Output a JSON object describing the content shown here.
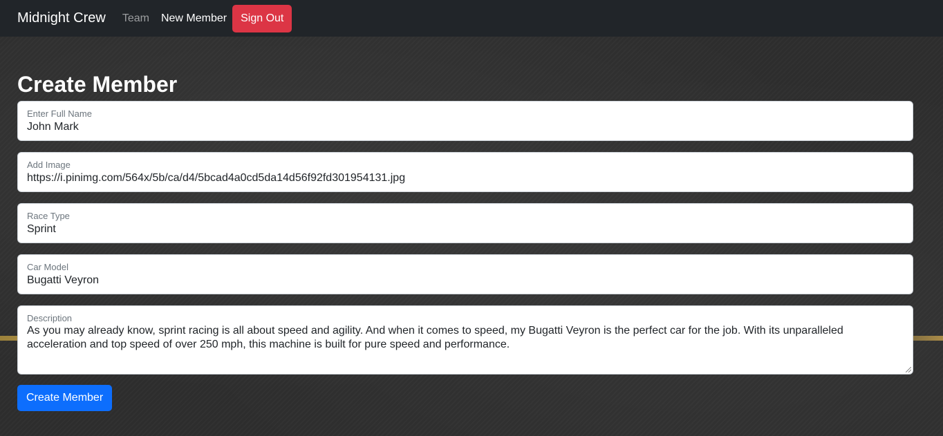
{
  "navbar": {
    "brand": "Midnight Crew",
    "links": [
      {
        "label": "Team"
      },
      {
        "label": "New Member"
      }
    ],
    "signout_label": "Sign Out"
  },
  "page": {
    "title": "Create Member"
  },
  "form": {
    "full_name": {
      "label": "Enter Full Name",
      "value": "John Mark"
    },
    "image": {
      "label": "Add Image",
      "value": "https://i.pinimg.com/564x/5b/ca/d4/5bcad4a0cd5da14d56f92fd301954131.jpg"
    },
    "race_type": {
      "label": "Race Type",
      "value": "Sprint"
    },
    "car_model": {
      "label": "Car Model",
      "value": "Bugatti Veyron"
    },
    "description": {
      "label": "Description",
      "value": "As you may already know, sprint racing is all about speed and agility. And when it comes to speed, my Bugatti Veyron is the perfect car for the job. With its unparalleled acceleration and top speed of over 250 mph, this machine is built for pure speed and performance."
    },
    "submit_label": "Create Member"
  },
  "colors": {
    "navbar_bg": "#212529",
    "signout_bg": "#dc3545",
    "primary": "#0d6efd"
  }
}
